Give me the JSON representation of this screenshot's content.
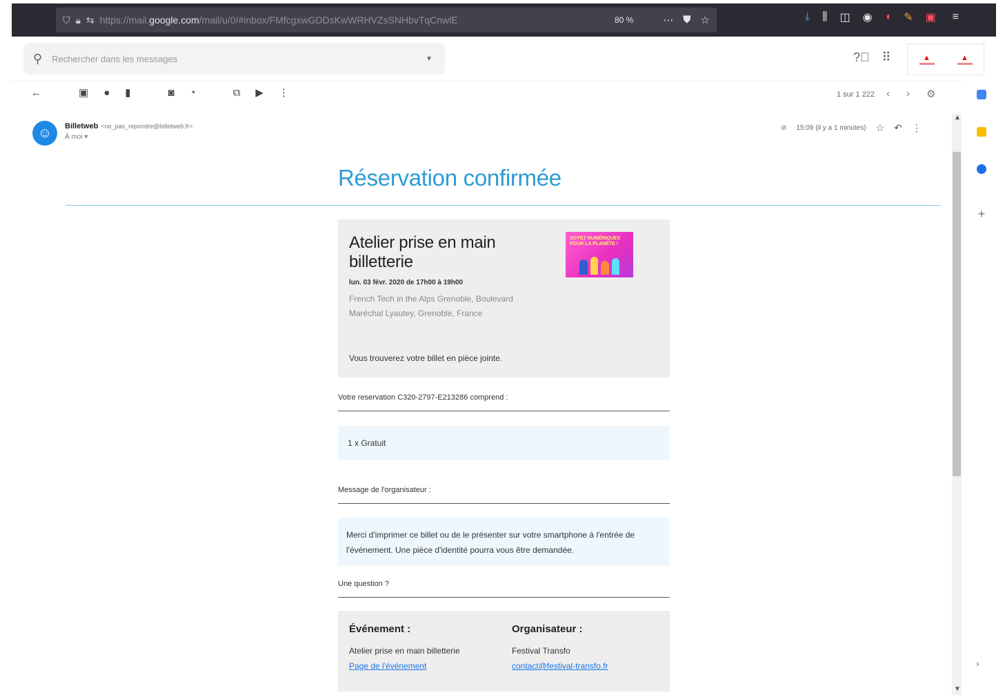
{
  "browser": {
    "url_prefix": "https://mail.",
    "url_domain": "google.com",
    "url_rest": "/mail/u/0/#inbox/FMfcgxwGDDsKwWRHVZsSNHbvTqCnwlE",
    "zoom": "80 %"
  },
  "gmail": {
    "search_placeholder": "Rechercher dans les messages",
    "pager": "1 sur 1 222"
  },
  "email": {
    "sender_name": "Billetweb",
    "sender_email": "<no_pas_repondre@billetweb.fr>",
    "recipient": "À moi",
    "time": "15:09 (il y a 1 minutes)",
    "title": "Réservation confirmée"
  },
  "event": {
    "name": "Atelier prise en main billetterie",
    "date": "lun. 03 févr. 2020 de 17h00 à 19h00",
    "address": "French Tech in the Alps Grenoble, Boulevard Maréchal Lyautey, Grenoble, France",
    "note": "Vous trouverez votre billet en pièce jointe.",
    "image_text": "SOYEZ NUMÉRIQUES POUR LA PLANÈTE !"
  },
  "reservation": {
    "intro": "Votre reservation C320-2797-E213286 comprend :",
    "item": "1 x Gratuit"
  },
  "organizer_message": {
    "label": "Message de l'organisateur :",
    "text": "Merci d'imprimer ce billet ou de le présenter sur votre smartphone à l'entrée de l'événement. Une pièce d'identité pourra vous être demandée."
  },
  "question": {
    "label": "Une question ?"
  },
  "info": {
    "event_heading": "Événement :",
    "event_name": "Atelier prise en main billetterie",
    "event_link": "Page de l'événement",
    "org_heading": "Organisateur :",
    "org_name": "Festival Transfo",
    "org_link": "contact@festival-transfo.fr"
  },
  "icons": {
    "browser": [
      "shield-icon",
      "lock-icon",
      "permissions-icon",
      "more-icon",
      "pocket-icon",
      "star-icon",
      "download-icon",
      "library-icon",
      "sidebar-icon",
      "account-icon",
      "extension-icon",
      "menu-icon"
    ],
    "toolbar": [
      "back-arrow-icon",
      "archive-icon",
      "report-spam-icon",
      "delete-icon",
      "mark-unread-icon",
      "snooze-icon",
      "move-to-icon",
      "label-icon",
      "more-vert-icon"
    ]
  },
  "colors": {
    "title_blue": "#2c9bd6",
    "card_gray": "#eeeeee",
    "box_blue": "#eef7fd",
    "browser_dark": "#2b2a33"
  }
}
